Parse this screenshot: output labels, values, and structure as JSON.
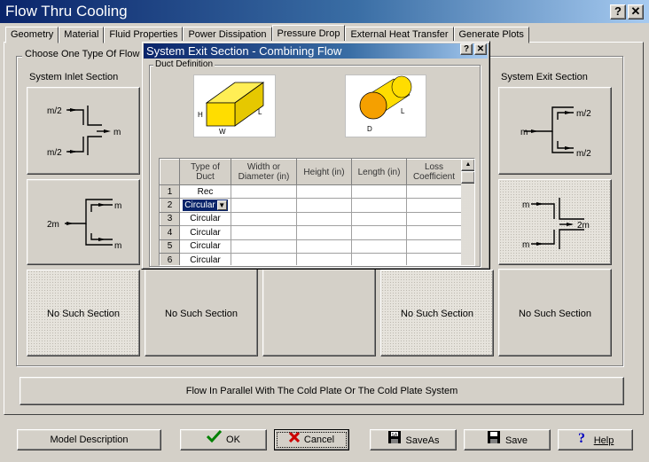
{
  "window": {
    "title": "Flow Thru Cooling",
    "help_glyph": "?",
    "close_glyph": "✕"
  },
  "tabs": [
    {
      "label": "Geometry"
    },
    {
      "label": "Material"
    },
    {
      "label": "Fluid Properties"
    },
    {
      "label": "Power Dissipation"
    },
    {
      "label": "Pressure Drop",
      "active": true
    },
    {
      "label": "External Heat Transfer"
    },
    {
      "label": "Generate Plots"
    }
  ],
  "group": {
    "legend": "Choose One Type Of Flow (",
    "inlet_label": "System Inlet Section",
    "exit_label": "System Exit Section",
    "no_such_section": "No Such Section"
  },
  "diagrams": {
    "inlet_split": {
      "top": "m/2",
      "mid": "m",
      "bottom": "m/2"
    },
    "inlet_combine": {
      "left": "2m",
      "top": "m",
      "bottom": "m"
    },
    "exit_split": {
      "left": "m",
      "top": "m/2",
      "bottom": "m/2"
    },
    "exit_combine": {
      "top": "m",
      "right": "2m",
      "bottom": "m"
    }
  },
  "flow_button": "Flow In Parallel With The Cold Plate Or The Cold Plate System",
  "buttons": {
    "model_description": "Model Description",
    "ok": "OK",
    "cancel": "Cancel",
    "save_as": "SaveAs",
    "save": "Save",
    "help": "Help"
  },
  "dialog": {
    "title": "System Exit Section  - Combining Flow",
    "help_glyph": "?",
    "close_glyph": "✕",
    "legend": "Duct Definition",
    "rect_labels": {
      "h": "H",
      "w": "W",
      "l": "L"
    },
    "circ_labels": {
      "d": "D",
      "l": "L"
    },
    "grid": {
      "headers": [
        "Type of Duct",
        "Width or Diameter (in)",
        "Height (in)",
        "Length (in)",
        "Loss Coefficient"
      ],
      "rows": [
        {
          "num": "1",
          "type": "Rec"
        },
        {
          "num": "2",
          "type": "Circular",
          "selected": true
        },
        {
          "num": "3",
          "type": "Circular"
        },
        {
          "num": "4",
          "type": "Circular"
        },
        {
          "num": "5",
          "type": "Circular"
        },
        {
          "num": "6",
          "type": "Circular"
        }
      ]
    }
  },
  "colors": {
    "title_bar": "#0a246a",
    "duct_fill": "#ffdd00",
    "cancel_x": "#cc0000",
    "ok_check": "#008000"
  }
}
